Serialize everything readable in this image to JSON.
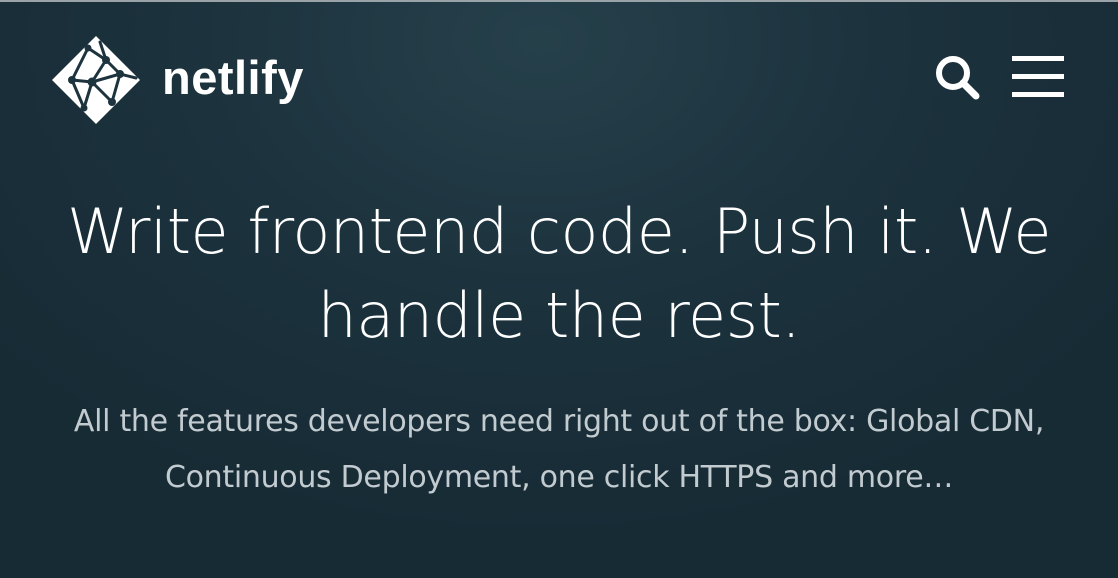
{
  "header": {
    "brand_name": "netlify",
    "logo_icon": "netlify-diamond-logo-icon",
    "search_icon": "search-icon",
    "menu_icon": "hamburger-menu-icon"
  },
  "hero": {
    "title": "Write frontend code. Push it. We handle the rest.",
    "subtitle": "All the features developers need right out of the box: Global CDN, Continuous Deployment, one click HTTPS and more…"
  },
  "colors": {
    "background": "#1b313c",
    "text_primary": "#ffffff",
    "text_secondary": "#c2cbcf"
  }
}
